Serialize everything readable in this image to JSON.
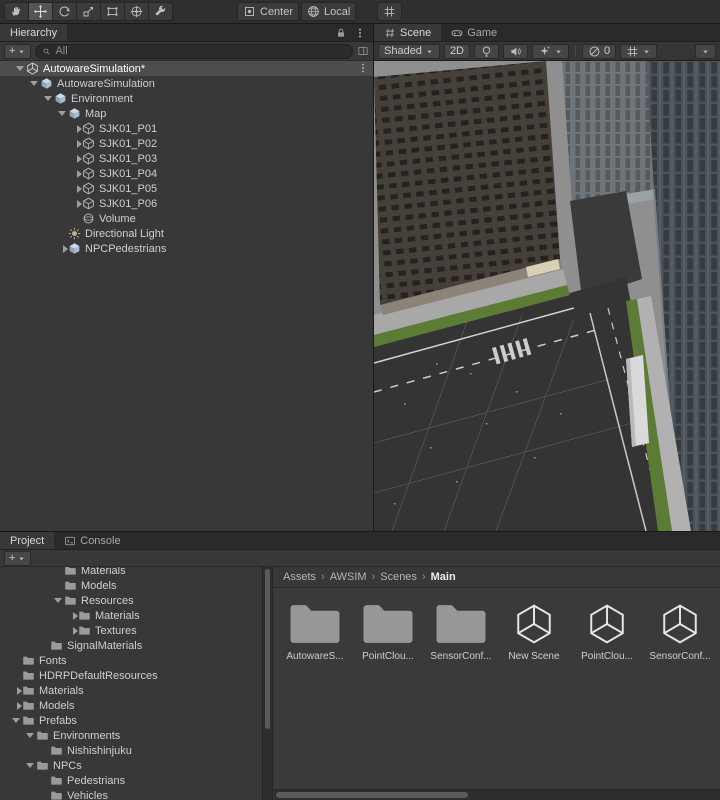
{
  "colors": {
    "selection": "#4d4d4d",
    "panel": "#383838",
    "tab_strip": "#2a2a2a",
    "grass_green": "#5c7c36",
    "asphalt": "#343434"
  },
  "top_toolbar": {
    "tools": [
      {
        "name": "hand-tool",
        "icon": "hand",
        "selected": false
      },
      {
        "name": "move-tool",
        "icon": "move",
        "selected": true
      },
      {
        "name": "rotate-tool",
        "icon": "rotate",
        "selected": false
      },
      {
        "name": "scale-tool",
        "icon": "scale",
        "selected": false
      },
      {
        "name": "rect-tool",
        "icon": "rect",
        "selected": false
      },
      {
        "name": "transform-tool",
        "icon": "transform",
        "selected": false
      },
      {
        "name": "custom-tools",
        "icon": "wrench",
        "selected": false
      }
    ],
    "pivot_button": "Center",
    "orientation_button": "Local"
  },
  "hierarchy": {
    "tab_label": "Hierarchy",
    "add_button": "+",
    "search_value": "All",
    "rows": [
      {
        "label": "AutowareSimulation*",
        "depth": 0,
        "arrow": "down",
        "icon": "unity",
        "selected": true,
        "menu": true
      },
      {
        "label": "AutowareSimulation",
        "depth": 1,
        "arrow": "down",
        "icon": "cube"
      },
      {
        "label": "Environment",
        "depth": 2,
        "arrow": "down",
        "icon": "cube"
      },
      {
        "label": "Map",
        "depth": 3,
        "arrow": "down",
        "icon": "cube"
      },
      {
        "label": "SJK01_P01",
        "depth": 4,
        "arrow": "right",
        "icon": "hexagon"
      },
      {
        "label": "SJK01_P02",
        "depth": 4,
        "arrow": "right",
        "icon": "hexagon"
      },
      {
        "label": "SJK01_P03",
        "depth": 4,
        "arrow": "right",
        "icon": "hexagon"
      },
      {
        "label": "SJK01_P04",
        "depth": 4,
        "arrow": "right",
        "icon": "hexagon"
      },
      {
        "label": "SJK01_P05",
        "depth": 4,
        "arrow": "right",
        "icon": "hexagon"
      },
      {
        "label": "SJK01_P06",
        "depth": 4,
        "arrow": "right",
        "icon": "hexagon"
      },
      {
        "label": "Volume",
        "depth": 4,
        "arrow": "none",
        "icon": "volume"
      },
      {
        "label": "Directional Light",
        "depth": 3,
        "arrow": "none",
        "icon": "sun"
      },
      {
        "label": "NPCPedestrians",
        "depth": 3,
        "arrow": "right",
        "icon": "cube"
      }
    ]
  },
  "scene_view": {
    "tabs": [
      {
        "label": "Scene",
        "icon": "scene-tab",
        "active": true
      },
      {
        "label": "Game",
        "icon": "gamepad",
        "active": false
      }
    ],
    "draw_mode": "Shaded",
    "toggle_2d": "2D",
    "visibility_count": "0"
  },
  "bottom": {
    "tabs": [
      {
        "label": "Project",
        "active": true
      },
      {
        "label": "Console",
        "icon": "console",
        "active": false
      }
    ],
    "add_button": "+",
    "tree_rows": [
      {
        "label": "Materials",
        "depth": 3,
        "arrow": "none"
      },
      {
        "label": "Models",
        "depth": 3,
        "arrow": "none"
      },
      {
        "label": "Resources",
        "depth": 3,
        "arrow": "down"
      },
      {
        "label": "Materials",
        "depth": 4,
        "arrow": "right"
      },
      {
        "label": "Textures",
        "depth": 4,
        "arrow": "right"
      },
      {
        "label": "SignalMaterials",
        "depth": 2,
        "arrow": "none"
      },
      {
        "label": "Fonts",
        "depth": 0,
        "arrow": "none"
      },
      {
        "label": "HDRPDefaultResources",
        "depth": 0,
        "arrow": "none"
      },
      {
        "label": "Materials",
        "depth": 0,
        "arrow": "right"
      },
      {
        "label": "Models",
        "depth": 0,
        "arrow": "right"
      },
      {
        "label": "Prefabs",
        "depth": 0,
        "arrow": "down"
      },
      {
        "label": "Environments",
        "depth": 1,
        "arrow": "down"
      },
      {
        "label": "Nishishinjuku",
        "depth": 2,
        "arrow": "none"
      },
      {
        "label": "NPCs",
        "depth": 1,
        "arrow": "down"
      },
      {
        "label": "Pedestrians",
        "depth": 2,
        "arrow": "none"
      },
      {
        "label": "Vehicles",
        "depth": 2,
        "arrow": "none"
      }
    ],
    "breadcrumb": [
      "Assets",
      "AWSIM",
      "Scenes",
      "Main"
    ],
    "assets": [
      {
        "label": "AutowareS...",
        "icon": "folder"
      },
      {
        "label": "PointClou...",
        "icon": "folder"
      },
      {
        "label": "SensorConf...",
        "icon": "folder"
      },
      {
        "label": "New Scene",
        "icon": "unity-scene"
      },
      {
        "label": "PointClou...",
        "icon": "unity-scene"
      },
      {
        "label": "SensorConf...",
        "icon": "unity-scene"
      }
    ]
  }
}
